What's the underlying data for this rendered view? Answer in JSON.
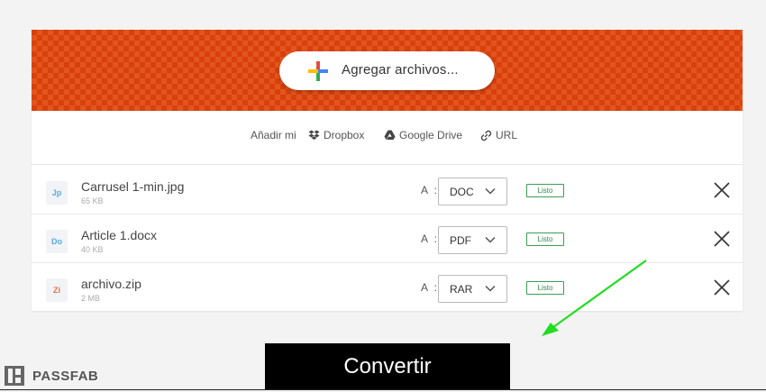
{
  "uploader": {
    "add_button_label": "Agregar archivos...",
    "sources": [
      {
        "label": "Añadir mi",
        "icon": ""
      },
      {
        "label": "Dropbox",
        "icon": "dropbox-icon"
      },
      {
        "label": "Google Drive",
        "icon": "google-drive-icon"
      },
      {
        "label": "URL",
        "icon": "link-icon"
      }
    ]
  },
  "files": [
    {
      "icon_text": "Jp",
      "icon_color": "#5aa9e6",
      "name": "Carrusel 1-min.jpg",
      "size": "65 KB",
      "to_label": "A :",
      "format": "DOC",
      "status": "Listo"
    },
    {
      "icon_text": "Do",
      "icon_color": "#5aa9e6",
      "name": "Article 1.docx",
      "size": "40 KB",
      "to_label": "A :",
      "format": "PDF",
      "status": "Listo"
    },
    {
      "icon_text": "Zi",
      "icon_color": "#e5734a",
      "name": "archivo.zip",
      "size": "2 MB",
      "to_label": "A :",
      "format": "RAR",
      "status": "Listo"
    }
  ],
  "convert_button_label": "Convertir",
  "watermark": {
    "text": "PASSFAB"
  },
  "colors": {
    "banner": "#d9400c",
    "status": "#3c9d55",
    "arrow": "#22dd22"
  }
}
